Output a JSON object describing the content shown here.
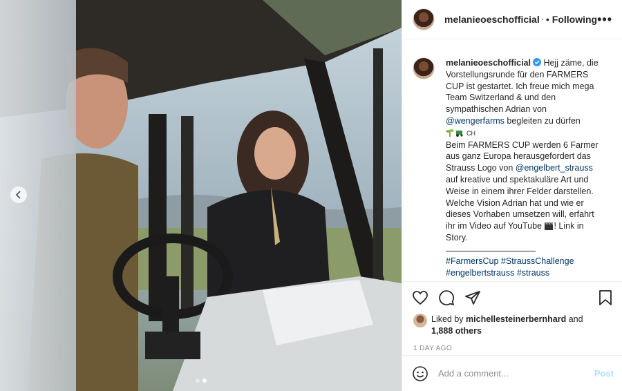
{
  "post": {
    "username": "melanieoeschofficial",
    "follow_state": "Following",
    "separator": "•",
    "more_label": "•••"
  },
  "caption": {
    "username": "melanieoeschofficial",
    "line1": " Hejj zäme, die Vorstellungsrunde für den FARMERS CUP ist gestartet. Ich freue mich mega Team Switzerland & und den sympathischen Adrian von ",
    "mention1": "@wengerfarms",
    "line2": " begleiten zu dürfen",
    "emoji_suffix": "CH",
    "para2a": "Beim FARMERS CUP werden 6 Farmer aus ganz Europa herausgefordert das Strauss Logo von ",
    "mention2": "@engelbert_strauss",
    "para2b": " auf kreative und spektakuläre Art und Weise in einem ihrer Felder darstellen. Welche Vision Adrian hat und wie er dieses Vorhaben umsetzen will, erfahrt ihr im Video auf YouTube ",
    "para2c": "! Link in Story.",
    "hashtags": [
      "#FarmersCup",
      "#StraussChallenge",
      "#engelbertstrauss",
      "#strauss"
    ]
  },
  "likes": {
    "prefix": "Liked by ",
    "user": "michellesteinerbernhard",
    "and": " and",
    "others": "1,888 others"
  },
  "timestamp": "1 DAY AGO",
  "comment": {
    "placeholder": "Add a comment...",
    "post_label": "Post"
  },
  "icons": {
    "verified": "verified-badge-icon",
    "like": "heart-icon",
    "comment": "comment-bubble-icon",
    "share": "paper-plane-icon",
    "save": "bookmark-icon",
    "emoji": "smiley-icon",
    "carousel_prev": "chevron-left-icon"
  },
  "colors": {
    "link": "#00376b",
    "verified": "#3897f0",
    "post_disabled": "#b2dffc",
    "muted": "#8e8e8e"
  },
  "carousel": {
    "total": 2,
    "active": 2
  }
}
